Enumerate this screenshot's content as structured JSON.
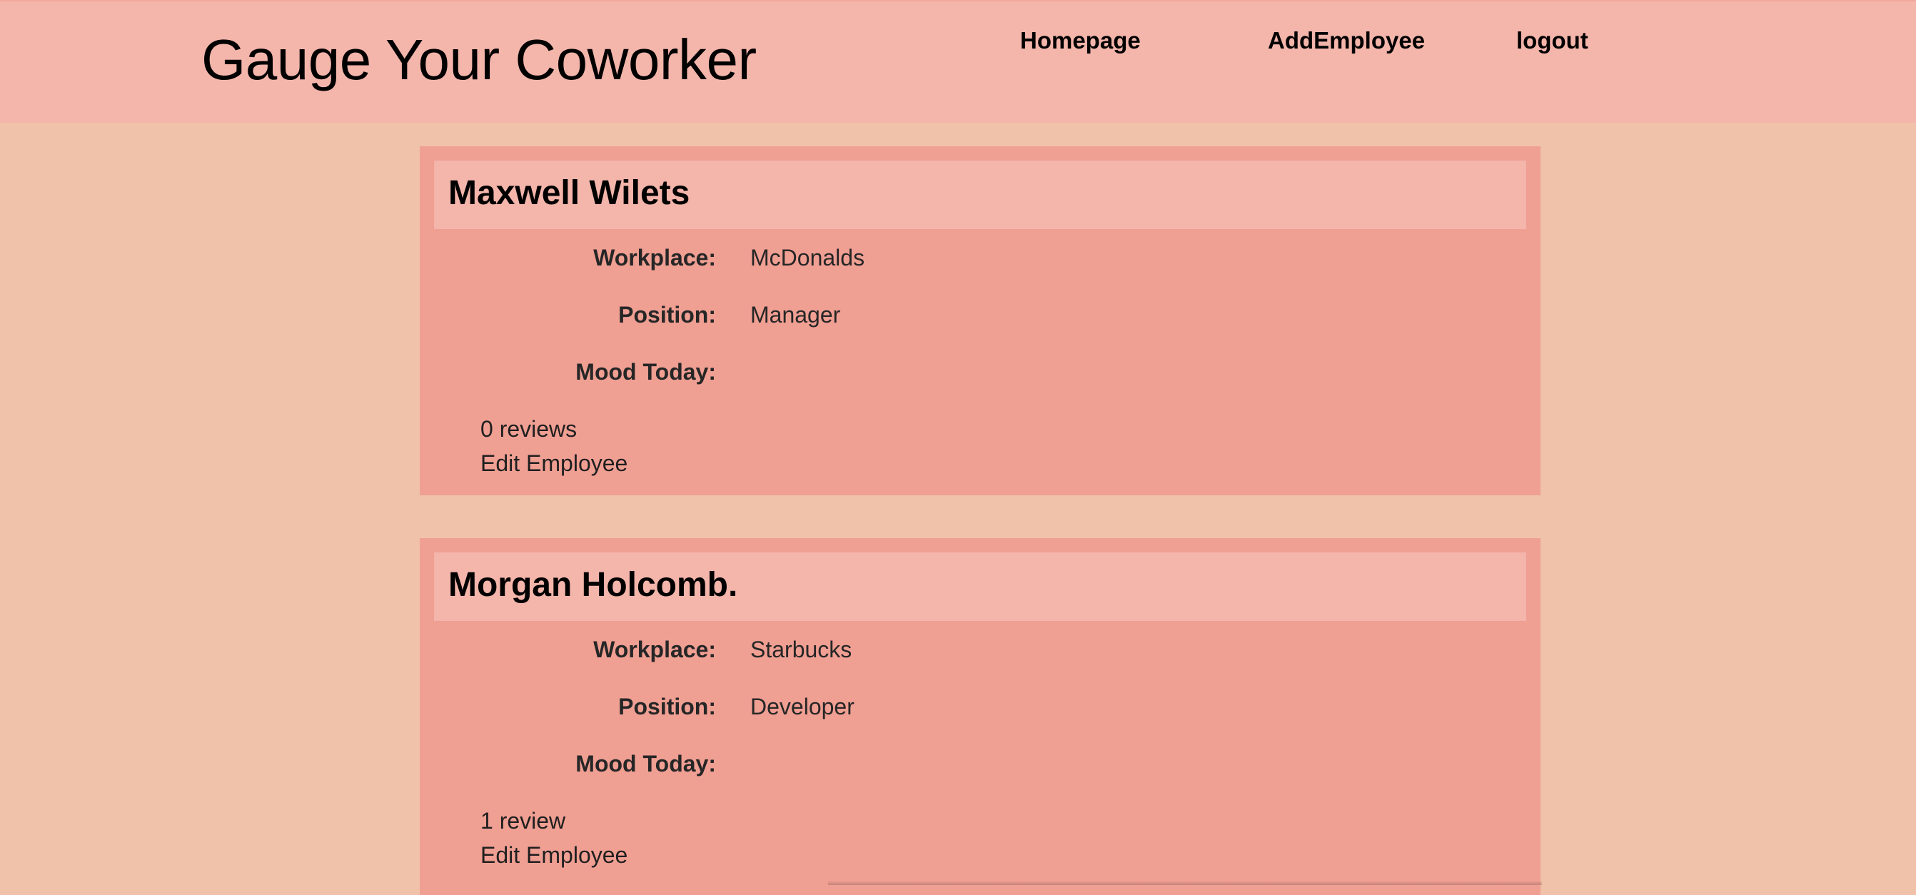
{
  "header": {
    "title": "Gauge Your Coworker",
    "nav": {
      "home": "Homepage",
      "add": "AddEmployee",
      "logout": "logout"
    }
  },
  "labels": {
    "workplace": "Workplace:",
    "position": "Position:",
    "mood": "Mood Today:",
    "edit": "Edit Employee"
  },
  "employees": [
    {
      "name": "Maxwell Wilets",
      "workplace": "McDonalds",
      "position": "Manager",
      "mood": "",
      "reviews": "0 reviews"
    },
    {
      "name": "Morgan Holcomb.",
      "workplace": "Starbucks",
      "position": "Developer",
      "mood": "",
      "reviews": "1 review"
    }
  ],
  "colors": {
    "page_background": "#f0c2a9",
    "header_background": "#f4b5ab",
    "card_background": "#f09f93"
  }
}
